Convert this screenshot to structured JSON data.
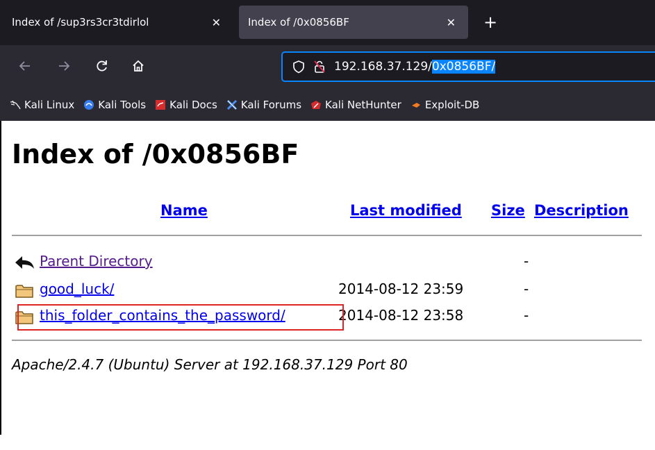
{
  "browser": {
    "tabs": [
      {
        "label": "Index of /sup3rs3cr3tdirlol",
        "active": false
      },
      {
        "label": "Index of /0x0856BF",
        "active": true
      }
    ],
    "new_tab_label": "+",
    "url": {
      "host": "192.168.37.129/",
      "path": "0x0856BF/"
    },
    "bookmarks": [
      {
        "label": "Kali Linux",
        "icon": "kali-dragon-icon"
      },
      {
        "label": "Kali Tools",
        "icon": "kali-tools-icon"
      },
      {
        "label": "Kali Docs",
        "icon": "kali-docs-icon"
      },
      {
        "label": "Kali Forums",
        "icon": "kali-forums-icon"
      },
      {
        "label": "Kali NetHunter",
        "icon": "kali-nethunter-icon"
      },
      {
        "label": "Exploit-DB",
        "icon": "exploit-db-icon"
      }
    ]
  },
  "page": {
    "title": "Index of /0x0856BF",
    "columns": {
      "name": "Name",
      "last_modified": "Last modified",
      "size": "Size",
      "description": "Description"
    },
    "rows": [
      {
        "name": "Parent Directory",
        "modified": "",
        "size": "-",
        "icon": "back-arrow-icon"
      },
      {
        "name": "good_luck/",
        "modified": "2014-08-12 23:59",
        "size": "-",
        "icon": "folder-icon"
      },
      {
        "name": "this_folder_contains_the_password/",
        "modified": "2014-08-12 23:58",
        "size": "-",
        "icon": "folder-icon"
      }
    ],
    "footer": "Apache/2.4.7 (Ubuntu) Server at 192.168.37.129 Port 80"
  },
  "colors": {
    "link": "#0000ee",
    "visited_link": "#551a8b",
    "highlight_box": "#e02424",
    "url_selection": "#0a84ff"
  }
}
